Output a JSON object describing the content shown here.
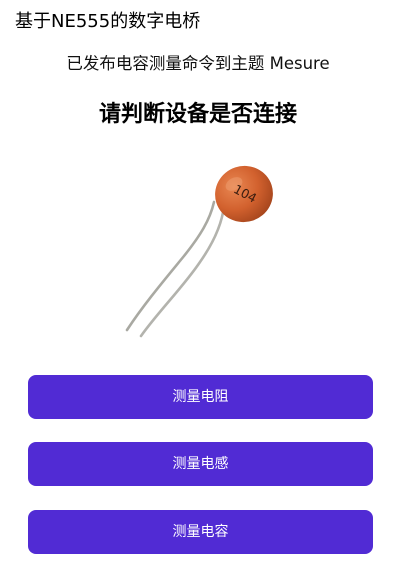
{
  "app": {
    "title": "基于NE555的数字电桥"
  },
  "status": {
    "message": "已发布电容测量命令到主题 Mesure"
  },
  "prompt": {
    "message": "请判断设备是否连接"
  },
  "image": {
    "icon": "ceramic-capacitor",
    "marking": "104",
    "body_color": "#d2612e",
    "lead_color": "#a9a9a2"
  },
  "buttons": {
    "resistance": "测量电阻",
    "inductance": "测量电感",
    "capacitance": "测量电容"
  },
  "colors": {
    "accent": "#512bd4",
    "button_text": "#ffffff"
  }
}
